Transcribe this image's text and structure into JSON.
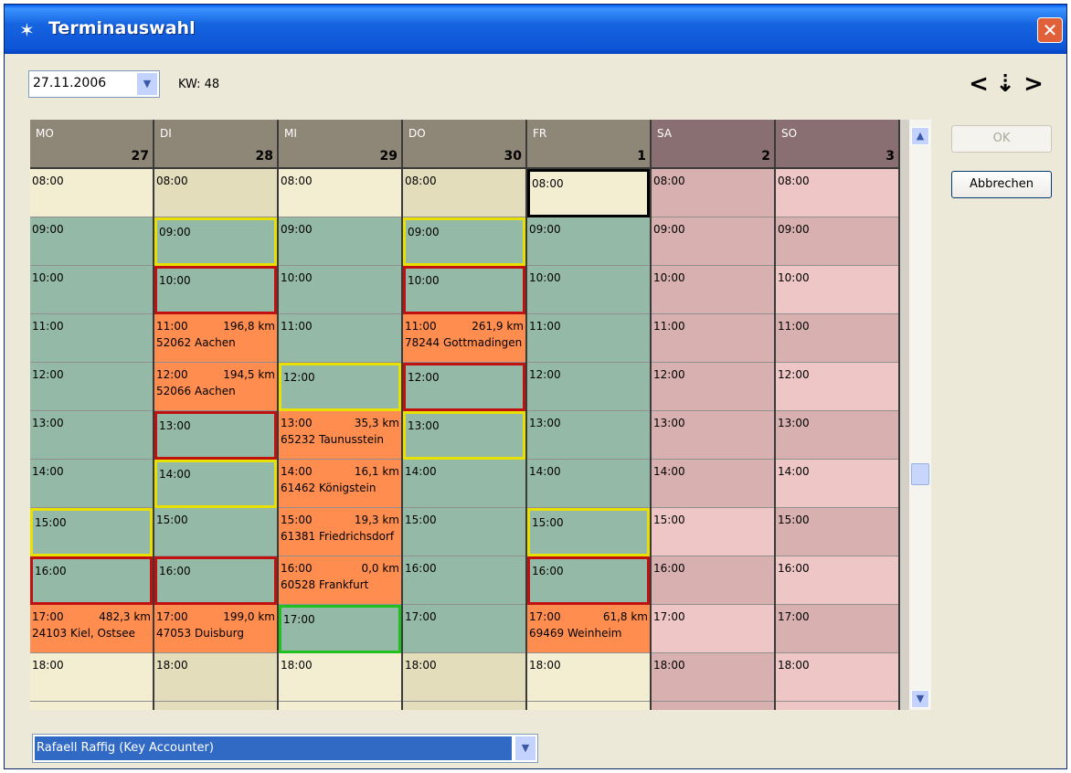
{
  "window": {
    "title": "Terminauswahl",
    "close_label": "✕"
  },
  "toolbar": {
    "date_value": "27.11.2006",
    "kw_label": "KW: 48",
    "nav_prev": "<",
    "nav_today": "⇣",
    "nav_next": ">",
    "dropdown_arrow": "▼"
  },
  "buttons": {
    "ok_label": "OK",
    "cancel_label": "Abbrechen"
  },
  "scrollbar": {
    "up_arrow": "▲",
    "down_arrow": "▼"
  },
  "person_select": {
    "value": "Rafaell Raffig (Key Accounter)",
    "arrow": "▼"
  },
  "colors": {
    "weekday_header": "#8e8677",
    "weekend_header": "#8a6f72",
    "cream": "#f3eed2",
    "tan": "#e4ddbb",
    "teal": "#94b9a7",
    "orange": "#ff8d4f",
    "pink": "#efc6c6",
    "border_yellow": "#e8e000",
    "border_red": "#c01010",
    "border_green": "#20c020"
  },
  "days": [
    {
      "name": "MO",
      "num": "27",
      "weekend": false,
      "slots": [
        {
          "time": "08:00",
          "color": "cream"
        },
        {
          "time": "09:00",
          "color": "teal"
        },
        {
          "time": "10:00",
          "color": "teal"
        },
        {
          "time": "11:00",
          "color": "teal"
        },
        {
          "time": "12:00",
          "color": "teal"
        },
        {
          "time": "13:00",
          "color": "teal"
        },
        {
          "time": "14:00",
          "color": "teal"
        },
        {
          "time": "15:00",
          "color": "teal",
          "border": "yellow"
        },
        {
          "time": "16:00",
          "color": "teal",
          "border": "red"
        },
        {
          "time": "17:00",
          "color": "orange",
          "km": "482,3 km",
          "addr": "24103 Kiel, Ostsee"
        },
        {
          "time": "18:00",
          "color": "cream"
        },
        {
          "time": "",
          "color": "cream"
        }
      ]
    },
    {
      "name": "DI",
      "num": "28",
      "weekend": false,
      "slots": [
        {
          "time": "08:00",
          "color": "tan"
        },
        {
          "time": "09:00",
          "color": "teal",
          "border": "yellow"
        },
        {
          "time": "10:00",
          "color": "teal",
          "border": "red"
        },
        {
          "time": "11:00",
          "color": "orange",
          "km": "196,8 km",
          "addr": "52062 Aachen"
        },
        {
          "time": "12:00",
          "color": "orange",
          "km": "194,5 km",
          "addr": "52066 Aachen"
        },
        {
          "time": "13:00",
          "color": "teal",
          "border": "red"
        },
        {
          "time": "14:00",
          "color": "teal",
          "border": "yellow"
        },
        {
          "time": "15:00",
          "color": "teal"
        },
        {
          "time": "16:00",
          "color": "teal",
          "border": "red"
        },
        {
          "time": "17:00",
          "color": "orange",
          "km": "199,0 km",
          "addr": "47053 Duisburg"
        },
        {
          "time": "18:00",
          "color": "tan"
        },
        {
          "time": "",
          "color": "tan"
        }
      ]
    },
    {
      "name": "MI",
      "num": "29",
      "weekend": false,
      "slots": [
        {
          "time": "08:00",
          "color": "cream"
        },
        {
          "time": "09:00",
          "color": "teal"
        },
        {
          "time": "10:00",
          "color": "teal"
        },
        {
          "time": "11:00",
          "color": "teal"
        },
        {
          "time": "12:00",
          "color": "teal",
          "border": "yellow"
        },
        {
          "time": "13:00",
          "color": "orange",
          "km": "35,3 km",
          "addr": "65232 Taunusstein"
        },
        {
          "time": "14:00",
          "color": "orange",
          "km": "16,1 km",
          "addr": "61462 Königstein"
        },
        {
          "time": "15:00",
          "color": "orange",
          "km": "19,3 km",
          "addr": "61381 Friedrichsdorf"
        },
        {
          "time": "16:00",
          "color": "orange",
          "km": "0,0 km",
          "addr": "60528 Frankfurt"
        },
        {
          "time": "17:00",
          "color": "teal",
          "border": "green"
        },
        {
          "time": "18:00",
          "color": "cream"
        },
        {
          "time": "",
          "color": "cream"
        }
      ]
    },
    {
      "name": "DO",
      "num": "30",
      "weekend": false,
      "slots": [
        {
          "time": "08:00",
          "color": "tan"
        },
        {
          "time": "09:00",
          "color": "teal",
          "border": "yellow"
        },
        {
          "time": "10:00",
          "color": "teal",
          "border": "red"
        },
        {
          "time": "11:00",
          "color": "orange",
          "km": "261,9 km",
          "addr": "78244 Gottmadingen"
        },
        {
          "time": "12:00",
          "color": "teal",
          "border": "red"
        },
        {
          "time": "13:00",
          "color": "teal",
          "border": "yellow"
        },
        {
          "time": "14:00",
          "color": "teal"
        },
        {
          "time": "15:00",
          "color": "teal"
        },
        {
          "time": "16:00",
          "color": "teal"
        },
        {
          "time": "17:00",
          "color": "teal"
        },
        {
          "time": "18:00",
          "color": "tan"
        },
        {
          "time": "",
          "color": "tan"
        }
      ]
    },
    {
      "name": "FR",
      "num": "1",
      "weekend": false,
      "slots": [
        {
          "time": "08:00",
          "color": "cream",
          "border": "black"
        },
        {
          "time": "09:00",
          "color": "teal"
        },
        {
          "time": "10:00",
          "color": "teal"
        },
        {
          "time": "11:00",
          "color": "teal"
        },
        {
          "time": "12:00",
          "color": "teal"
        },
        {
          "time": "13:00",
          "color": "teal"
        },
        {
          "time": "14:00",
          "color": "teal"
        },
        {
          "time": "15:00",
          "color": "teal",
          "border": "yellow"
        },
        {
          "time": "16:00",
          "color": "teal",
          "border": "red"
        },
        {
          "time": "17:00",
          "color": "orange",
          "km": "61,8 km",
          "addr": "69469 Weinheim"
        },
        {
          "time": "18:00",
          "color": "cream"
        },
        {
          "time": "",
          "color": "cream"
        }
      ]
    },
    {
      "name": "SA",
      "num": "2",
      "weekend": true,
      "slots": [
        {
          "time": "08:00",
          "color": "pinkdk"
        },
        {
          "time": "09:00",
          "color": "pinkdk"
        },
        {
          "time": "10:00",
          "color": "pinkdk"
        },
        {
          "time": "11:00",
          "color": "pinkdk"
        },
        {
          "time": "12:00",
          "color": "pinkdk"
        },
        {
          "time": "13:00",
          "color": "pinkdk"
        },
        {
          "time": "14:00",
          "color": "pinkdk"
        },
        {
          "time": "15:00",
          "color": "pink"
        },
        {
          "time": "16:00",
          "color": "pinkdk"
        },
        {
          "time": "17:00",
          "color": "pink"
        },
        {
          "time": "18:00",
          "color": "pinkdk"
        },
        {
          "time": "",
          "color": "pinkdk"
        }
      ]
    },
    {
      "name": "SO",
      "num": "3",
      "weekend": true,
      "slots": [
        {
          "time": "08:00",
          "color": "pink"
        },
        {
          "time": "09:00",
          "color": "pinkdk"
        },
        {
          "time": "10:00",
          "color": "pink"
        },
        {
          "time": "11:00",
          "color": "pinkdk"
        },
        {
          "time": "12:00",
          "color": "pink"
        },
        {
          "time": "13:00",
          "color": "pinkdk"
        },
        {
          "time": "14:00",
          "color": "pink"
        },
        {
          "time": "15:00",
          "color": "pinkdk"
        },
        {
          "time": "16:00",
          "color": "pink"
        },
        {
          "time": "17:00",
          "color": "pinkdk"
        },
        {
          "time": "18:00",
          "color": "pink"
        },
        {
          "time": "",
          "color": "pink"
        }
      ]
    }
  ]
}
